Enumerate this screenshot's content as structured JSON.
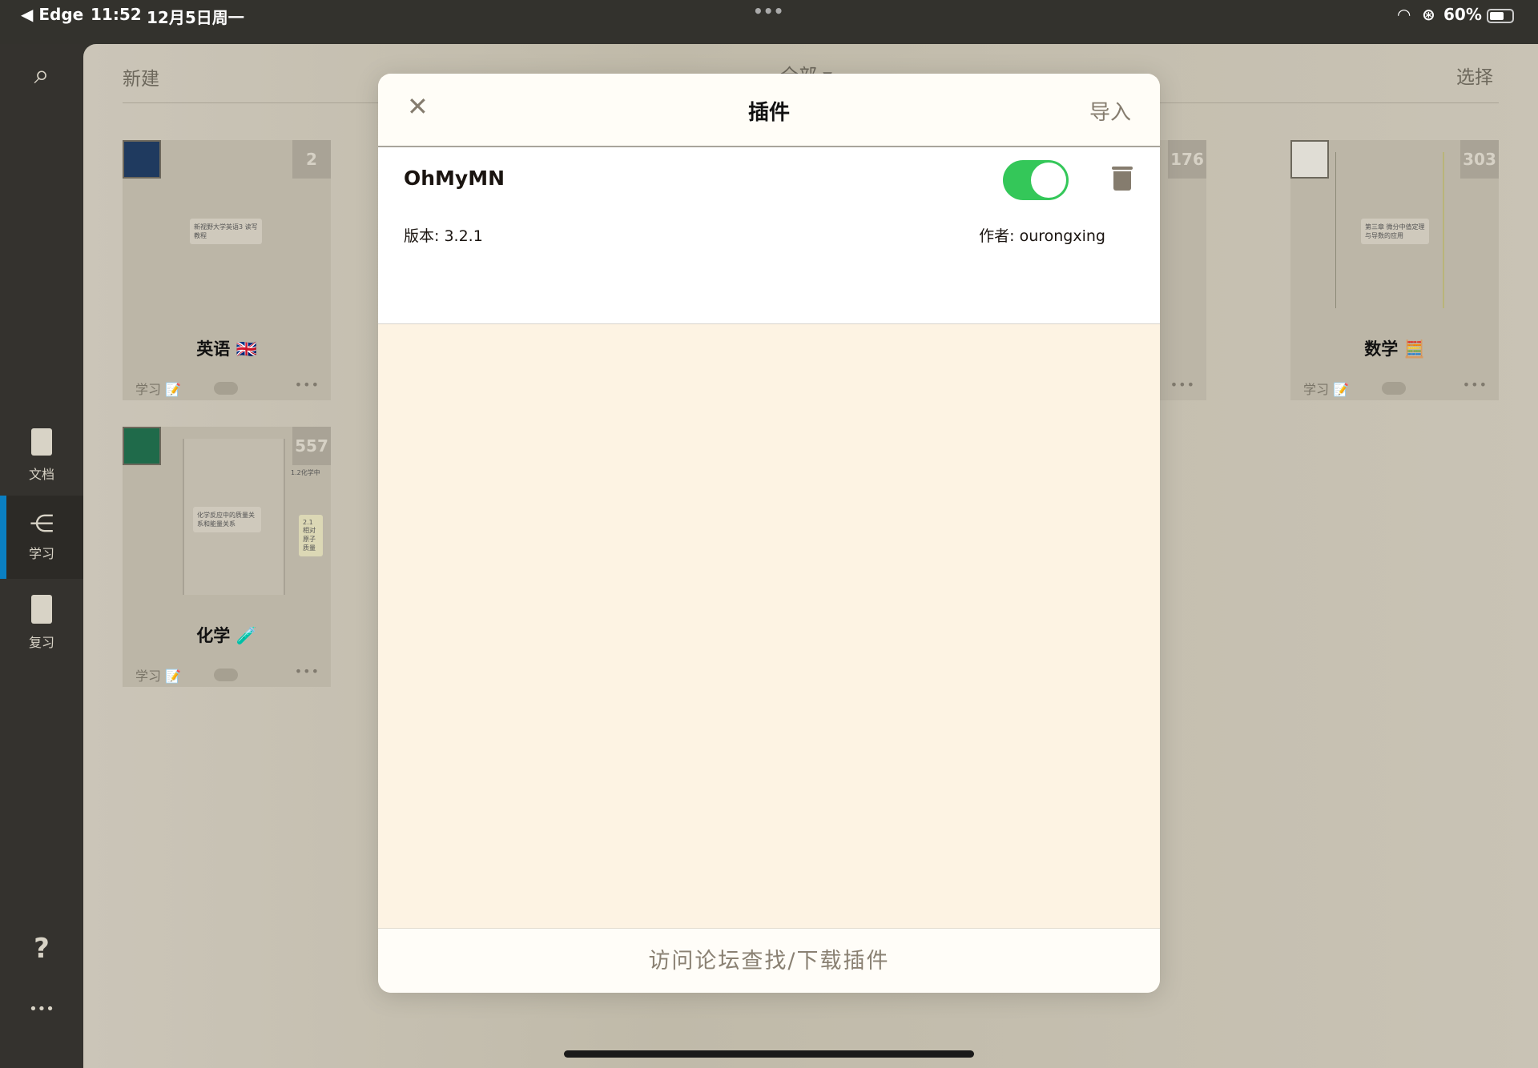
{
  "status_bar": {
    "back_app": "◀ Edge",
    "time": "11:52",
    "date": "12月5日周一",
    "battery": "60%",
    "center_dots": "•••"
  },
  "sidebar": {
    "items": [
      {
        "label": "文档",
        "icon": "document-icon"
      },
      {
        "label": "学习",
        "icon": "mindmap-icon",
        "selected": true
      },
      {
        "label": "复习",
        "icon": "clipboard-review-icon"
      }
    ],
    "help": "?",
    "more": "•••"
  },
  "header": {
    "new": "新建",
    "filter": "全部 ▾",
    "select": "选择"
  },
  "cards": [
    {
      "title": "英语 🇬🇧",
      "count": "2",
      "node": "新视野大学英语3 读写教程",
      "tag": "学习 📝"
    },
    {
      "title": "化学 🧪",
      "count": "557",
      "node": "化学反应中的质量关系和能量关系",
      "side": "1.2化学中",
      "side2": "2.1 相对原子质量",
      "tag": "学习 📝"
    },
    {
      "title": "",
      "count": "176",
      "tag": ""
    },
    {
      "title": "数学 🧮",
      "count": "303",
      "node": "第三章 微分中值定理与导数的应用",
      "tag": "学习 📝"
    }
  ],
  "modal": {
    "title": "插件",
    "import": "导入",
    "close": "✕",
    "plugin": {
      "name": "OhMyMN",
      "enabled": true,
      "version": "版本: 3.2.1",
      "author": "作者: ourongxing"
    },
    "footer": "访问论坛查找/下载插件"
  },
  "colors": {
    "toggle_on": "#34c759",
    "accent_selected": "#0a7fc2"
  }
}
